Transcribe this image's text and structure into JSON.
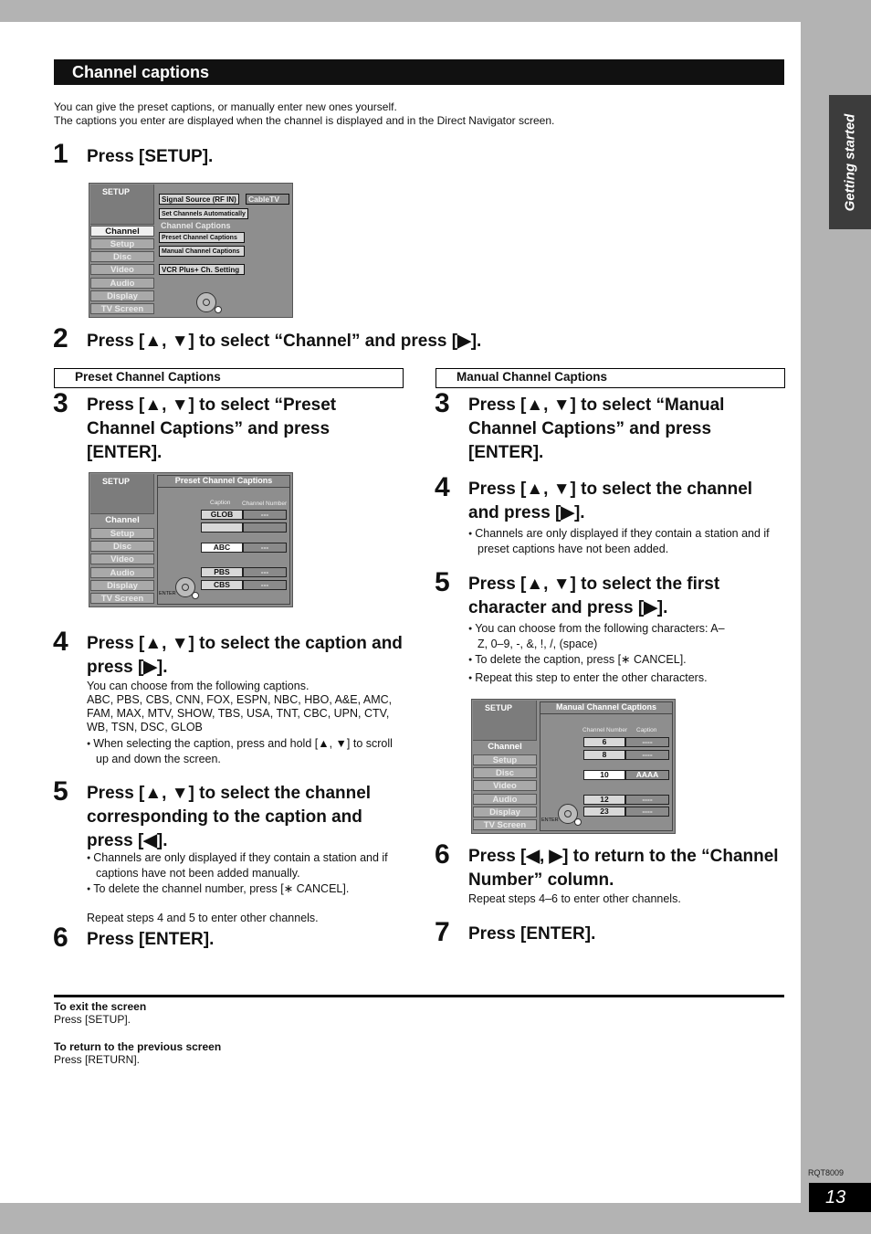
{
  "section_title": "Channel captions",
  "side_tab": "Getting started",
  "intro": [
    "You can give the preset captions, or manually enter new ones yourself.",
    "The captions you enter are displayed when the channel is displayed and in the Direct Navigator screen."
  ],
  "step1": {
    "num": "1",
    "title": "Press [SETUP]."
  },
  "step2": {
    "num": "2",
    "title": "Press [▲, ▼] to select “Channel” and press [▶]."
  },
  "osd_menu": [
    "Channel",
    "Setup",
    "Disc",
    "Video",
    "Audio",
    "Display",
    "TV Screen"
  ],
  "osd1": {
    "header": "SETUP",
    "signal_source_label": "Signal Source (RF IN)",
    "signal_source_value": "CableTV",
    "set_channels": "Set Channels Automatically",
    "captions_heading": "Channel Captions",
    "preset": "Preset Channel Captions",
    "manual": "Manual Channel Captions",
    "vcr_plus": "VCR Plus+ Ch. Setting"
  },
  "preset": {
    "subhead": "Preset Channel Captions",
    "step3": {
      "num": "3",
      "title": "Press [▲, ▼] to select “Preset Channel Captions” and press [ENTER]."
    },
    "osd": {
      "header": "SETUP",
      "title": "Preset Channel Captions",
      "col_caption": "Caption",
      "col_channel": "Channel Number",
      "enter_label": "ENTER",
      "rows": [
        {
          "caption": "GLOB",
          "channel": "---"
        },
        {
          "caption": "",
          "channel": ""
        },
        {
          "caption": "ABC",
          "channel": "---"
        },
        {
          "caption": "PBS",
          "channel": "---"
        },
        {
          "caption": "CBS",
          "channel": "---"
        }
      ]
    },
    "step4": {
      "num": "4",
      "title": "Press [▲, ▼] to select the caption and press [▶].",
      "body": "You can choose from the following captions.",
      "captions_list": "ABC, PBS, CBS, CNN, FOX, ESPN, NBC, HBO, A&E, AMC, FAM, MAX, MTV, SHOW, TBS, USA, TNT, CBC, UPN, CTV, WB, TSN, DSC, GLOB",
      "bullet": "When selecting the caption, press and hold [▲, ▼] to scroll up and down the screen."
    },
    "step5": {
      "num": "5",
      "title": "Press [▲, ▼] to select the channel corresponding to the caption and press [◀].",
      "bullets": [
        "Channels are only displayed if they contain a station and if captions have not been added manually.",
        "To delete the channel number, press [∗ CANCEL]."
      ],
      "repeat": "Repeat steps 4 and 5 to enter other channels."
    },
    "step6": {
      "num": "6",
      "title": "Press [ENTER]."
    }
  },
  "manual": {
    "subhead": "Manual Channel Captions",
    "step3": {
      "num": "3",
      "title": "Press [▲, ▼] to select “Manual Channel Captions” and press [ENTER]."
    },
    "step4": {
      "num": "4",
      "title": "Press [▲, ▼] to select the channel and press [▶].",
      "bullet": "Channels are only displayed if they contain a station and if preset captions have not been added."
    },
    "step5": {
      "num": "5",
      "title": "Press [▲, ▼] to select the first character and press [▶].",
      "bullets": [
        "You can choose from the following characters: A–Z, 0–9, -, &, !, /, (space)",
        "To delete the caption, press [∗ CANCEL].",
        "Repeat this step to enter the other characters."
      ]
    },
    "osd": {
      "header": "SETUP",
      "title": "Manual Channel Captions",
      "col_channel": "Channel Number",
      "col_caption": "Caption",
      "enter_label": "ENTER",
      "rows": [
        {
          "channel": "6",
          "caption": "----"
        },
        {
          "channel": "8",
          "caption": "----"
        },
        {
          "channel": "10",
          "caption": "AAAA"
        },
        {
          "channel": "12",
          "caption": "----"
        },
        {
          "channel": "23",
          "caption": "----"
        }
      ]
    },
    "step6": {
      "num": "6",
      "title": "Press [◀, ▶] to return to the “Channel Number” column.",
      "body": "Repeat steps 4–6 to enter other channels."
    },
    "step7": {
      "num": "7",
      "title": "Press [ENTER]."
    }
  },
  "footer": {
    "exit_heading": "To exit the screen",
    "exit_text": "Press [SETUP].",
    "return_heading": "To return to the previous screen",
    "return_text": "Press [RETURN]."
  },
  "model_code": "RQT8009",
  "page_number": "13"
}
